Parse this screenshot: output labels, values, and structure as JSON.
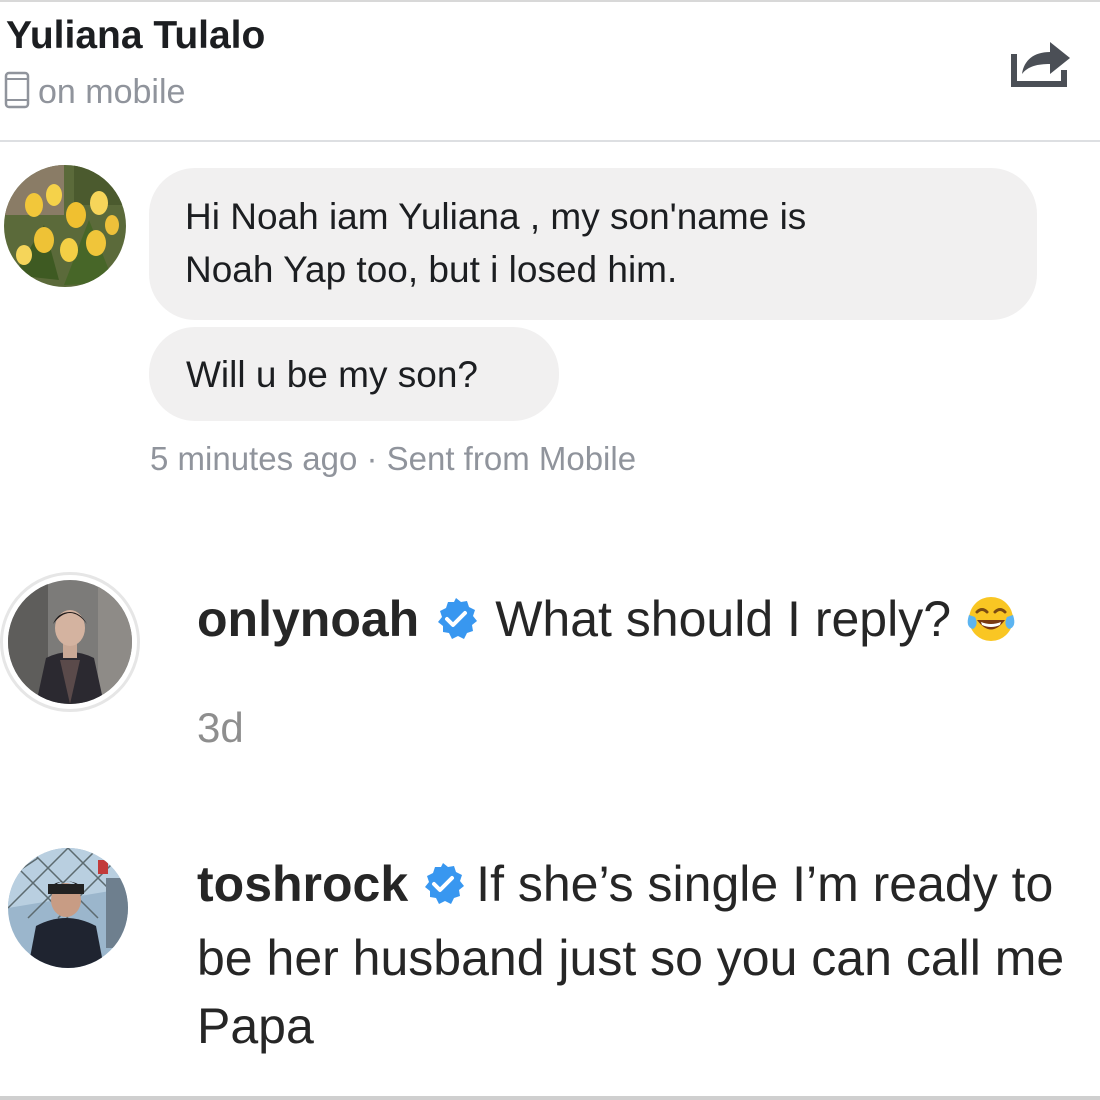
{
  "header": {
    "contact_name": "Yuliana Tulalo",
    "status_text": "on mobile",
    "status_icon": "mobile-phone-icon",
    "share_icon": "share-icon"
  },
  "messages": [
    {
      "text_lines": [
        "Hi Noah iam Yuliana , my son'name is",
        "Noah Yap too, but i losed him."
      ]
    },
    {
      "text": "Will u be my son?"
    }
  ],
  "message_meta": "5 minutes ago · Sent from Mobile",
  "comments": [
    {
      "username": "onlynoah",
      "verified": true,
      "text": "What should I reply?",
      "emoji": "face-with-tears-of-joy",
      "age": "3d"
    },
    {
      "username": "toshrock",
      "verified": true,
      "text": "If she’s single I’m ready to be her husband just so you can call me Papa"
    }
  ],
  "colors": {
    "bubble": "#f1f0f0",
    "meta_text": "#90949c",
    "verified_badge": "#3897f0",
    "divider": "#dddfe2"
  }
}
